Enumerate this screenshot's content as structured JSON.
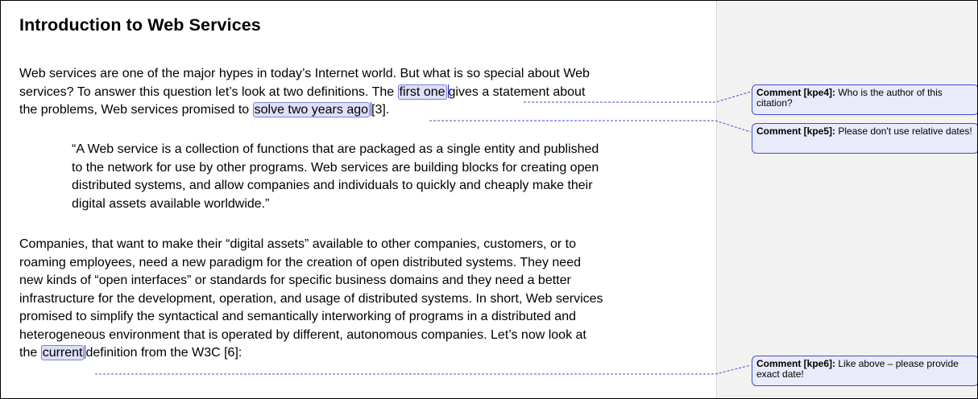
{
  "document": {
    "title": "Introduction to Web Services",
    "paragraph1": {
      "lines": [
        [
          "Web services are one of the major hypes in today’s Internet world. But what is so special about Web"
        ],
        [
          "services? To answer this question let’s look at two definitions. The ",
          "first one",
          "gives a statement about"
        ],
        [
          "the problems, Web services promised to ",
          "solve two years ago",
          "[3]."
        ]
      ]
    },
    "quote": {
      "lines": [
        "“A Web service is a collection of functions that are packaged as a single entity and published",
        "to the network for use by other programs. Web services are building blocks for creating open",
        "distributed systems, and allow companies and individuals to quickly and cheaply make their",
        "digital assets available worldwide.”"
      ]
    },
    "paragraph3": {
      "lines": [
        "Companies, that want to make their “digital assets” available to other companies, customers, or to",
        "roaming employees, need a new paradigm for the creation of open distributed systems. They need",
        "new kinds of “open interfaces” or standards for specific business domains and they need a better",
        "infrastructure for the development, operation, and usage of distributed systems. In short, Web services",
        "promised to simplify the syntactical and semantically interworking of programs in a distributed and",
        "heterogeneous environment that is operated by different, autonomous companies. Let’s now look at"
      ],
      "last_line": [
        "the ",
        "current",
        "definition from the W3C [6]:"
      ]
    }
  },
  "comments": [
    {
      "label": "Comment [kpe4]:",
      "text": " Who is the author of this citation?"
    },
    {
      "label": "Comment [kpe5]:",
      "text": " Please don't use relative dates!"
    },
    {
      "label": "Comment [kpe6]:",
      "text": " Like above – please provide exact date!"
    }
  ],
  "colors": {
    "highlight_fill": "#dde0f7",
    "highlight_border": "#7b82d8",
    "comment_border": "#3f4fd6",
    "comment_fill": "#e9ebfb",
    "margin_bg": "#f2f2f2"
  }
}
